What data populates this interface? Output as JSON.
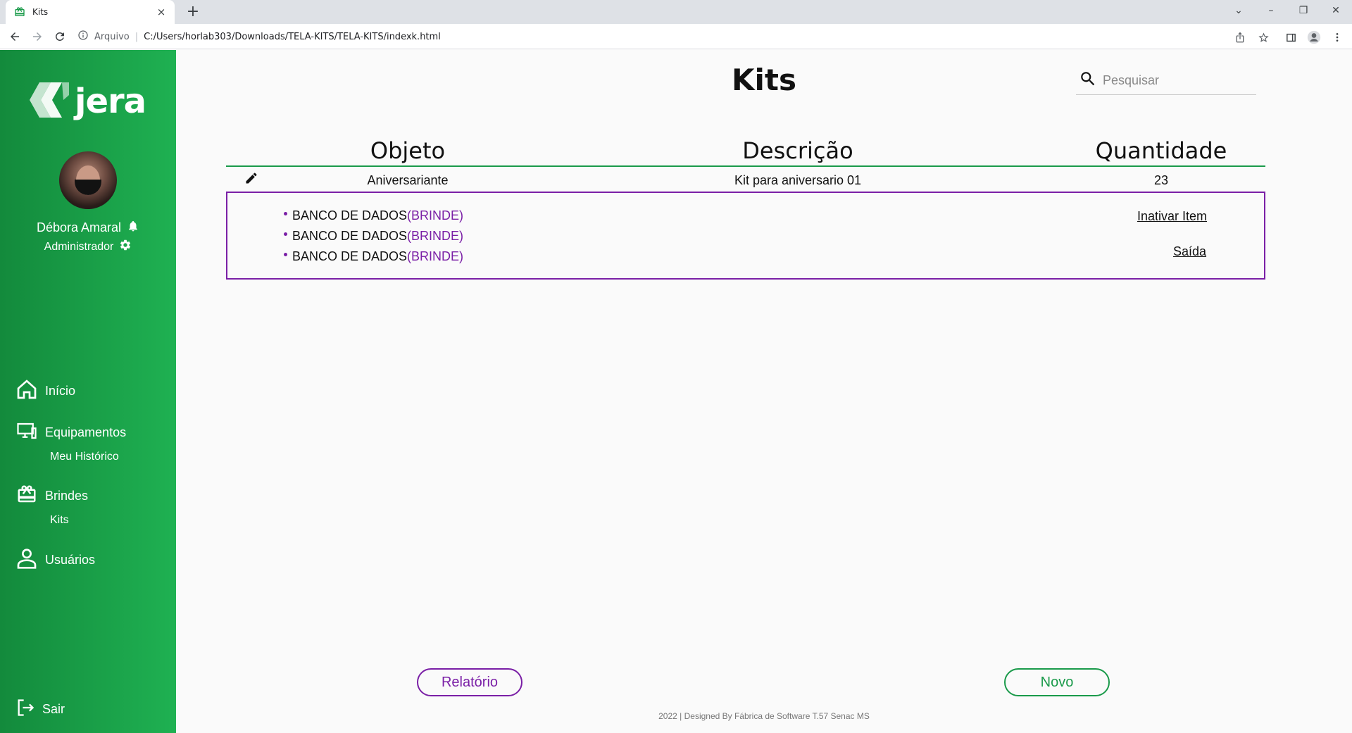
{
  "browser": {
    "tab_title": "Kits",
    "tab_close": "×",
    "new_tab": "+",
    "url_scheme": "Arquivo",
    "url_separator": "|",
    "url": "C:/Users/horlab303/Downloads/TELA-KITS/TELA-KITS/indexk.html",
    "controls": {
      "tab_search": "⌄",
      "minimize": "–",
      "restore": "❐",
      "close": "✕"
    }
  },
  "sidebar": {
    "logo": "jera",
    "user_name": "Débora Amaral",
    "user_role": "Administrador",
    "nav": [
      {
        "label": "Início",
        "icon": "home-icon"
      },
      {
        "label": "Equipamentos",
        "icon": "monitor-icon",
        "sub": "Meu Histórico"
      },
      {
        "label": "Brindes",
        "icon": "gift-icon",
        "sub": "Kits"
      },
      {
        "label": "Usuários",
        "icon": "user-icon"
      }
    ],
    "logout": "Sair"
  },
  "main": {
    "title": "Kits",
    "search": {
      "placeholder": "Pesquisar"
    },
    "table": {
      "headers": [
        "Objeto",
        "Descrição",
        "Quantidade"
      ],
      "row": {
        "objeto": "Aniversariante",
        "descricao": "Kit para aniversario 01",
        "quantidade": "23"
      }
    },
    "kit_items": [
      {
        "name": "BANCO DE DADOS",
        "tag": "(BRINDE)"
      },
      {
        "name": "BANCO DE DADOS",
        "tag": "(BRINDE)"
      },
      {
        "name": "BANCO DE DADOS",
        "tag": "(BRINDE)"
      }
    ],
    "actions": {
      "deactivate": "Inativar Item",
      "exit": "Saída"
    },
    "buttons": {
      "report": "Relatório",
      "new": "Novo"
    },
    "footer": "2022 | Designed By Fábrica de Software T.57 Senac MS"
  },
  "colors": {
    "green": "#1a9a4a",
    "purple": "#7a1fa6",
    "sidebar_start": "#138a3c",
    "sidebar_end": "#1fb152"
  }
}
